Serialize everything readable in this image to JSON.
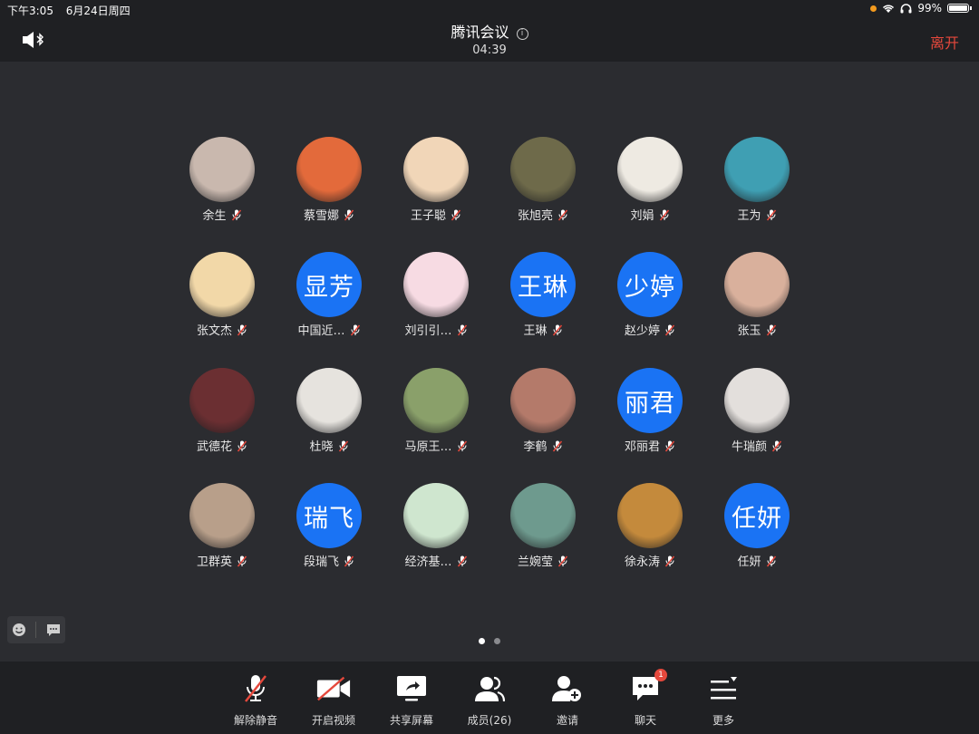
{
  "status_bar": {
    "time": "下午3:05",
    "date": "6月24日周四",
    "battery": "99%"
  },
  "header": {
    "title": "腾讯会议",
    "timer": "04:39",
    "leave_label": "离开"
  },
  "participants": [
    {
      "name": "余生",
      "avatar": "photo",
      "color": "#c9b8ae"
    },
    {
      "name": "蔡雪娜",
      "avatar": "photo",
      "color": "#e36a3b"
    },
    {
      "name": "王子聪",
      "avatar": "photo",
      "color": "#f1d6b8"
    },
    {
      "name": "张旭亮",
      "avatar": "photo",
      "color": "#6e6a4a"
    },
    {
      "name": "刘娟",
      "avatar": "photo",
      "color": "#eeeae2"
    },
    {
      "name": "王为",
      "avatar": "photo",
      "color": "#3f9fb3"
    },
    {
      "name": "张文杰",
      "avatar": "photo",
      "color": "#f2d8a8"
    },
    {
      "name": "中国近…",
      "avatar": "text",
      "text": "显芳",
      "color": "#1a73f4"
    },
    {
      "name": "刘引引…",
      "avatar": "photo",
      "color": "#f7dbe3"
    },
    {
      "name": "王琳",
      "avatar": "text",
      "text": "王琳",
      "color": "#1a73f4"
    },
    {
      "name": "赵少婷",
      "avatar": "text",
      "text": "少婷",
      "color": "#1a73f4"
    },
    {
      "name": "张玉",
      "avatar": "photo",
      "color": "#d9b09c"
    },
    {
      "name": "武德花",
      "avatar": "photo",
      "color": "#6b2f32"
    },
    {
      "name": "杜晓",
      "avatar": "photo",
      "color": "#e6e3de"
    },
    {
      "name": "马原王…",
      "avatar": "photo",
      "color": "#8aa06a"
    },
    {
      "name": "李鹤",
      "avatar": "photo",
      "color": "#b47a6a"
    },
    {
      "name": "邓丽君",
      "avatar": "text",
      "text": "丽君",
      "color": "#1a73f4"
    },
    {
      "name": "牛瑞颜",
      "avatar": "photo",
      "color": "#e3dfdc"
    },
    {
      "name": "卫群英",
      "avatar": "photo",
      "color": "#b89f8a"
    },
    {
      "name": "段瑞飞",
      "avatar": "text",
      "text": "瑞飞",
      "color": "#1a73f4"
    },
    {
      "name": "经济基…",
      "avatar": "photo",
      "color": "#cfe6cf"
    },
    {
      "name": "兰婉莹",
      "avatar": "photo",
      "color": "#6e9a8e"
    },
    {
      "name": "徐永涛",
      "avatar": "photo",
      "color": "#c48a3c"
    },
    {
      "name": "任妍",
      "avatar": "text",
      "text": "任妍",
      "color": "#1a73f4"
    }
  ],
  "toolbar": [
    {
      "label": "解除静音",
      "icon": "mic-muted-icon"
    },
    {
      "label": "开启视频",
      "icon": "video-off-icon"
    },
    {
      "label": "共享屏幕",
      "icon": "share-screen-icon"
    },
    {
      "label": "成员(26)",
      "icon": "members-icon"
    },
    {
      "label": "邀请",
      "icon": "invite-icon"
    },
    {
      "label": "聊天",
      "icon": "chat-icon"
    },
    {
      "label": "更多",
      "icon": "more-icon"
    }
  ],
  "chat_badge": "1",
  "pagination": {
    "pages": 2,
    "current": 1
  },
  "colors": {
    "accent_blue": "#1a73f4",
    "leave_red": "#e5483c",
    "mute_red": "#e5483c"
  }
}
